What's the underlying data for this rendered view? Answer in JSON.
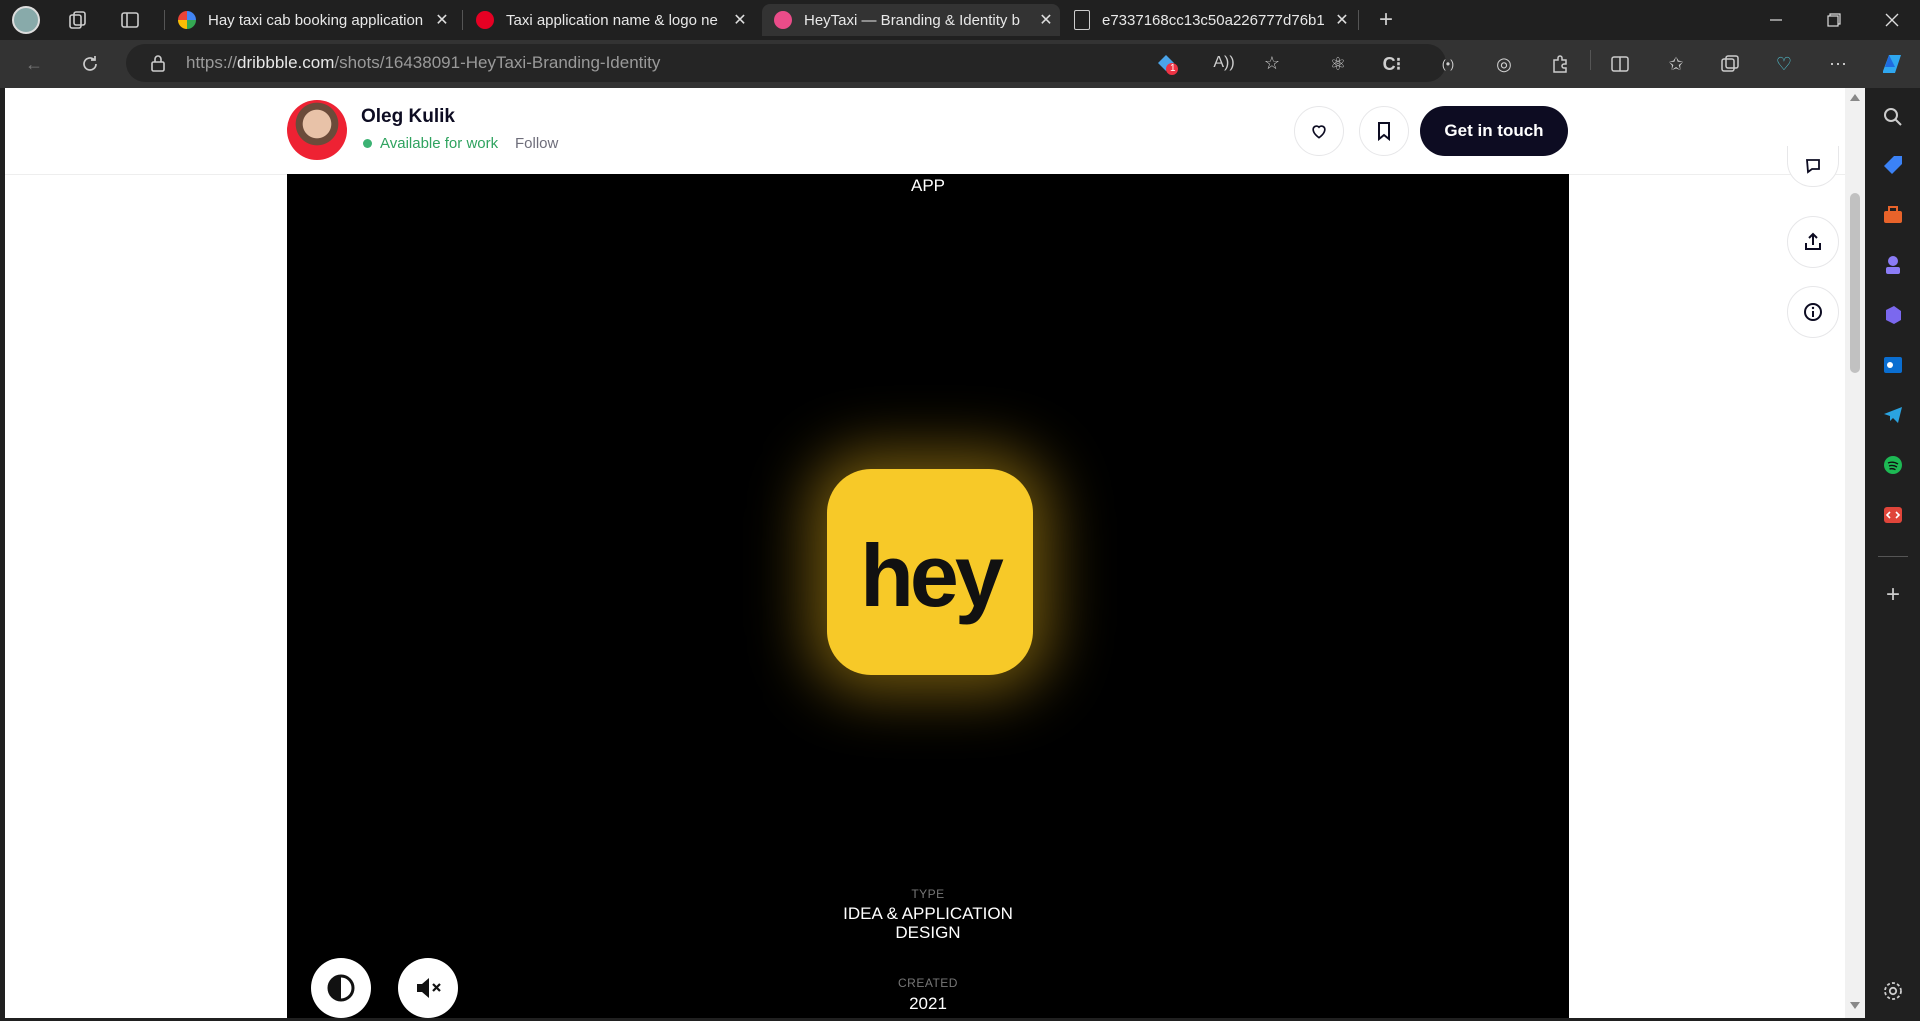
{
  "browser": {
    "tabs": [
      {
        "title": "Hay taxi cab booking application",
        "favicon": "google-icon"
      },
      {
        "title": "Taxi application name & logo ne",
        "favicon": "pinterest-icon"
      },
      {
        "title": "HeyTaxi — Branding & Identity b",
        "favicon": "dribbble-icon",
        "active": true
      },
      {
        "title": "e7337168cc13c50a226777d76b1",
        "favicon": "file-icon"
      }
    ],
    "url_prefix": "https://",
    "url_domain": "dribbble.com",
    "url_path": "/shots/16438091-HeyTaxi-Branding-Identity",
    "badge_count": "1"
  },
  "header": {
    "author_name": "Oleg Kulik",
    "availability": "Available for work",
    "follow_label": "Follow",
    "cta_label": "Get in touch"
  },
  "shot": {
    "top_label": "APP",
    "logo_text": "hey",
    "type_label": "TYPE",
    "type_value_line1": "IDEA & APPLICATION",
    "type_value_line2": "DESIGN",
    "created_label": "CREATED",
    "created_value": "2021"
  },
  "colors": {
    "accent": "#f7c928",
    "cta_bg": "#0d0c22",
    "available": "#2fa35f"
  }
}
